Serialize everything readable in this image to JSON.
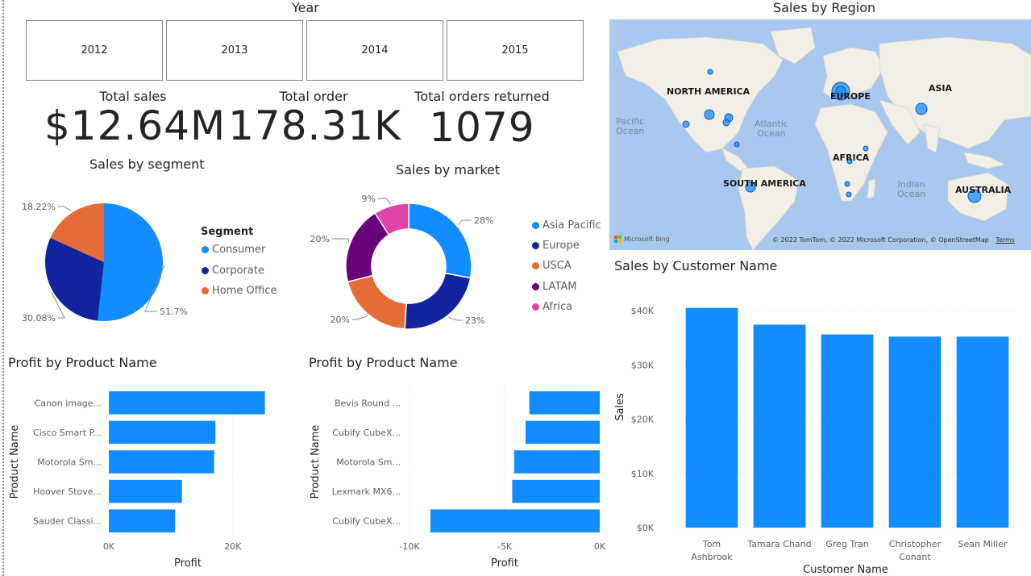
{
  "slicer": {
    "title": "Year",
    "options": [
      "2012",
      "2013",
      "2014",
      "2015"
    ]
  },
  "kpis": [
    {
      "label": "Total sales",
      "value": "$12.64M"
    },
    {
      "label": "Total order",
      "value": "178.31K"
    },
    {
      "label": "Total orders returned",
      "value": "1079"
    }
  ],
  "segment": {
    "title": "Sales by segment",
    "legend_title": "Segment",
    "items": [
      {
        "label": "Consumer",
        "pct_label": "51.7%",
        "value": 51.7,
        "color": "#118DFF"
      },
      {
        "label": "Corporate",
        "pct_label": "30.08%",
        "value": 30.08,
        "color": "#12239E"
      },
      {
        "label": "Home Office",
        "pct_label": "18.22%",
        "value": 18.22,
        "color": "#E66C37"
      }
    ]
  },
  "market": {
    "title": "Sales by market",
    "items": [
      {
        "label": "Asia Pacific",
        "pct_label": "28%",
        "value": 28,
        "color": "#118DFF"
      },
      {
        "label": "Europe",
        "pct_label": "23%",
        "value": 23,
        "color": "#12239E"
      },
      {
        "label": "USCA",
        "pct_label": "20%",
        "value": 20,
        "color": "#E66C37"
      },
      {
        "label": "LATAM",
        "pct_label": "20%",
        "value": 20,
        "color": "#6B007B"
      },
      {
        "label": "Africa",
        "pct_label": "9%",
        "value": 9,
        "color": "#E044A7"
      }
    ]
  },
  "map": {
    "title": "Sales by Region",
    "continents": [
      "NORTH AMERICA",
      "EUROPE",
      "ASIA",
      "AFRICA",
      "SOUTH AMERICA",
      "AUSTRALIA"
    ],
    "oceans": [
      "Pacific\nOcean",
      "Atlantic\nOcean",
      "Indian\nOcean"
    ],
    "bing_label": "Microsoft Bing",
    "credits": "© 2022 TomTom, © 2022 Microsoft Corporation, © OpenStreetMap",
    "terms": "Terms"
  },
  "chart_data": [
    {
      "type": "bar",
      "orientation": "horizontal",
      "title": "Profit by Product Name",
      "xlabel": "Profit",
      "ylabel": "Product Name",
      "categories": [
        "Canon image...",
        "Cisco Smart P...",
        "Motorola Sm...",
        "Hoover Stove...",
        "Sauder Classi..."
      ],
      "values": [
        25200,
        17200,
        17000,
        11800,
        10700
      ],
      "xlim": [
        0,
        25500
      ],
      "xticks": [
        0,
        20000
      ],
      "xtick_labels": [
        "0K",
        "20K"
      ],
      "color": "#118DFF"
    },
    {
      "type": "bar",
      "orientation": "horizontal",
      "title": "Profit by Product Name",
      "xlabel": "Profit",
      "ylabel": "Product Name",
      "categories": [
        "Bevis Round ...",
        "Cubify CubeX...",
        "Motorola Sm...",
        "Lexmark MX6...",
        "Cubify CubeX..."
      ],
      "values": [
        -3700,
        -3900,
        -4500,
        -4600,
        -8900
      ],
      "xlim": [
        -10000,
        0
      ],
      "xticks": [
        -10000,
        -5000,
        0
      ],
      "xtick_labels": [
        "-10K",
        "-5K",
        "0K"
      ],
      "color": "#118DFF"
    },
    {
      "type": "bar",
      "title": "Sales by Customer Name",
      "xlabel": "Customer Name",
      "ylabel": "Sales",
      "categories": [
        "Tom Ashbrook",
        "Tamara Chand",
        "Greg Tran",
        "Christopher Conant",
        "Sean Miller"
      ],
      "category_lines": [
        [
          "Tom",
          "Ashbrook"
        ],
        [
          "Tamara Chand"
        ],
        [
          "Greg Tran"
        ],
        [
          "Christopher",
          "Conant"
        ],
        [
          "Sean Miller"
        ]
      ],
      "values": [
        40500,
        37400,
        35600,
        35200,
        35200
      ],
      "ylim": [
        0,
        40000
      ],
      "yticks": [
        0,
        10000,
        20000,
        30000,
        40000
      ],
      "ytick_labels": [
        "$0K",
        "$10K",
        "$20K",
        "$30K",
        "$40K"
      ],
      "color": "#118DFF"
    },
    {
      "type": "pie",
      "title": "Sales by segment",
      "categories": [
        "Consumer",
        "Corporate",
        "Home Office"
      ],
      "values": [
        51.7,
        30.08,
        18.22
      ]
    },
    {
      "type": "pie",
      "title": "Sales by market",
      "categories": [
        "Asia Pacific",
        "Europe",
        "USCA",
        "LATAM",
        "Africa"
      ],
      "values": [
        28,
        23,
        20,
        20,
        9
      ]
    }
  ]
}
